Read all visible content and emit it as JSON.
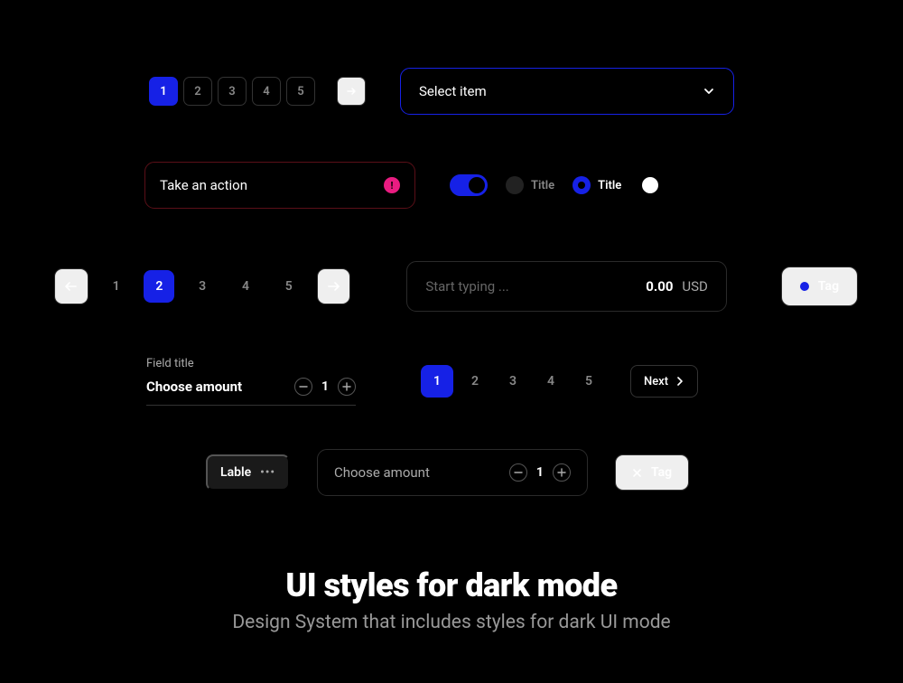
{
  "pagination_small": {
    "active": 1,
    "pages": [
      "1",
      "2",
      "3",
      "4",
      "5"
    ]
  },
  "dropdown": {
    "label": "Select item"
  },
  "action_input": {
    "text": "Take an action",
    "error_symbol": "!"
  },
  "radio_unchecked_label": "Title",
  "radio_checked_label": "Title",
  "pagination_arrows": {
    "active": 2,
    "pages": [
      "1",
      "2",
      "3",
      "4",
      "5"
    ]
  },
  "typing_input": {
    "placeholder": "Start typing ...",
    "amount": "0.00",
    "currency": "USD"
  },
  "tag_blue": "Tag",
  "field_stepper": {
    "title": "Field title",
    "label": "Choose amount",
    "value": "1"
  },
  "pagination_next": {
    "active": 1,
    "pages": [
      "1",
      "2",
      "3",
      "4",
      "5"
    ],
    "next_label": "Next"
  },
  "label_chip": "Lable",
  "amount_box": {
    "placeholder": "Choose amount",
    "value": "1"
  },
  "tag_close": "Tag",
  "footer": {
    "title": "UI styles for dark mode",
    "subtitle": "Design System that includes styles for dark UI mode"
  }
}
